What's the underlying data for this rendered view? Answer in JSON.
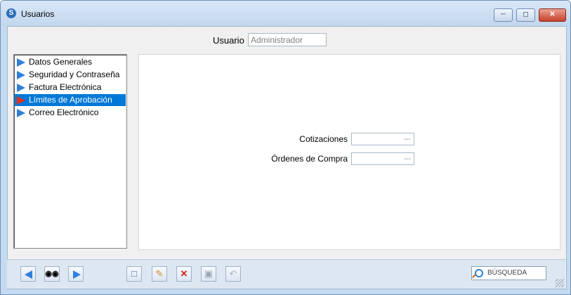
{
  "window": {
    "title": "Usuarios",
    "icon": "app-swirl-icon"
  },
  "titlebar_buttons": {
    "minimize": "minimize-icon",
    "maximize": "maximize-icon",
    "close": "close-icon"
  },
  "user": {
    "label": "Usuario",
    "value": "Administrador"
  },
  "nav": {
    "items": [
      {
        "label": "Datos Generales",
        "selected": false
      },
      {
        "label": "Seguridad y Contraseña",
        "selected": false
      },
      {
        "label": "Factura Electrónica",
        "selected": false
      },
      {
        "label": "Límites de Aprobación",
        "selected": true
      },
      {
        "label": "Correo Electrónico",
        "selected": false
      }
    ]
  },
  "limits": {
    "quotes_label": "Cotizaciones",
    "quotes_value": "---",
    "orders_label": "Órdenes de Compra",
    "orders_value": "---"
  },
  "toolbar": {
    "search_label": "BÚSQUEDA"
  },
  "colors": {
    "selection": "#0078d7",
    "nav_arrow": "#2f7fd8",
    "active_arrow": "#e1321e",
    "close_button": "#c7412b"
  }
}
